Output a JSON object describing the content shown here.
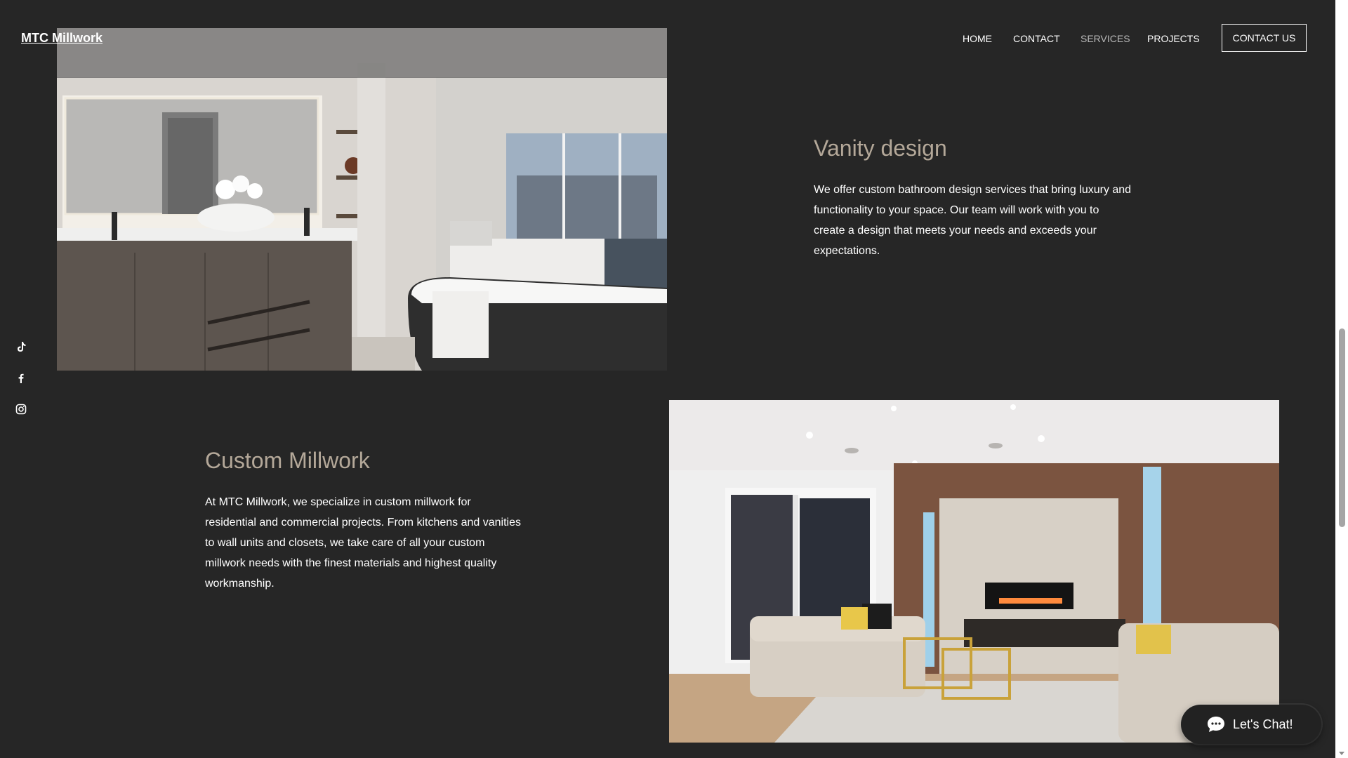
{
  "site": {
    "logo": "MTC Millwork"
  },
  "nav": {
    "items": [
      {
        "label": "HOME"
      },
      {
        "label": "CONTACT"
      },
      {
        "label": "SERVICES",
        "active": true
      },
      {
        "label": "PROJECTS"
      }
    ],
    "cta_label": "CONTACT US"
  },
  "social": {
    "icons": [
      "tiktok-icon",
      "facebook-icon",
      "instagram-icon"
    ]
  },
  "sections": {
    "vanity": {
      "title": "Vanity design",
      "body": "We offer custom bathroom design services that bring luxury and functionality to your space. Our team will work with you to create a design that meets your needs and exceeds your expectations."
    },
    "millwork": {
      "title": "Custom Millwork",
      "body": "At MTC Millwork, we specialize in custom millwork for residential and commercial projects. From kitchens and vanities to wall units and closets, we take care of all your custom millwork needs with the finest materials and highest quality workmanship."
    }
  },
  "chat": {
    "label": "Let's Chat!"
  },
  "colors": {
    "background": "#262626",
    "title": "#b4a899",
    "text": "#ffffff"
  }
}
